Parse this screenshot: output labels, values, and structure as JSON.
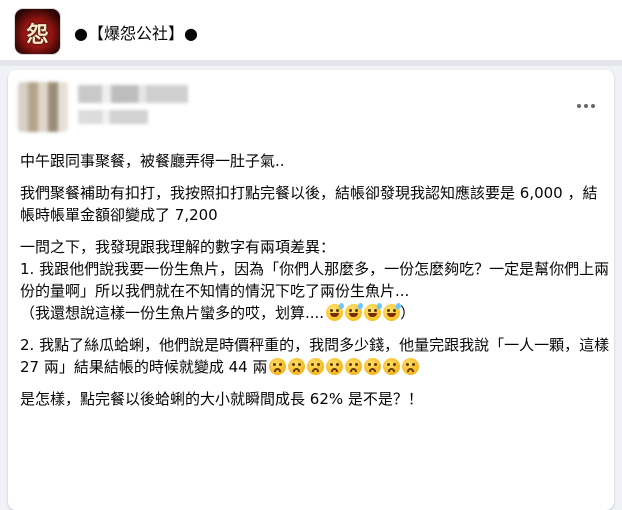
{
  "group": {
    "name": "●【爆怨公社】●",
    "avatar_icon": "group-logo-icon",
    "avatar_glyph": "怨"
  },
  "post": {
    "more_icon": "more-options-icon",
    "paragraphs": [
      "中午跟同事聚餐，被餐廳弄得一肚子氣..",
      "我們聚餐補助有扣打，我按照扣打點完餐以後，結帳卻發現我認知應該要是 6,000 ，結帳時帳單金額卻變成了 7,200",
      "一問之下，我發現跟我理解的數字有兩項差異：",
      "1. 我跟他們說我要一份生魚片，因為「你們人那麼多，一份怎麼夠吃？一定是幫你們上兩份的量啊」所以我們就在不知情的情況下吃了兩份生魚片...",
      "（我還想說這樣一份生魚片蠻多的哎，划算....",
      "）",
      "2. 我點了絲瓜蛤蜊，他們說是時價秤重的，我問多少錢，他量完跟我說「一人一顆，這樣 27 兩」結果結帳的時候就變成 44 兩",
      "是怎樣，點完餐以後蛤蜊的大小就瞬間成長 62% 是不是？！"
    ],
    "emojis": {
      "sweat_smile_count": 4,
      "frown_count": 8,
      "sweat_smile_icon": "grinning-sweat-emoji-icon",
      "frown_icon": "frowning-open-mouth-emoji-icon"
    }
  }
}
